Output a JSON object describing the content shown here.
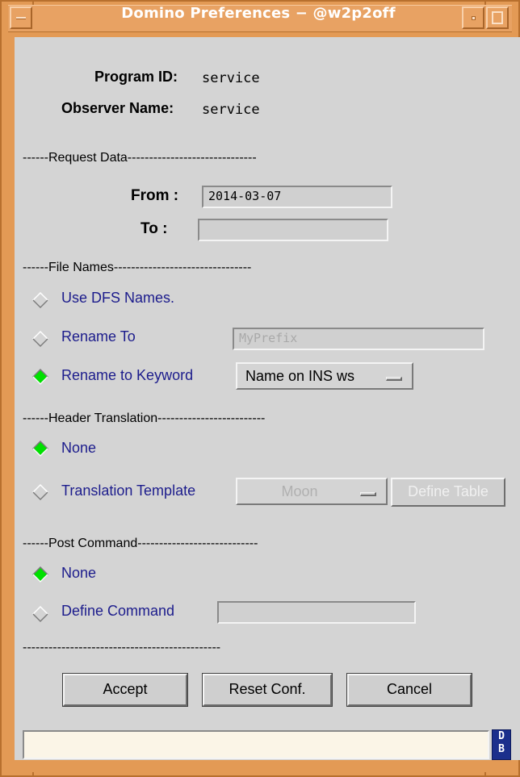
{
  "window": {
    "title": "Domino Preferences − @w2p2off"
  },
  "info": {
    "program_id_label": "Program ID:",
    "program_id_value": "service",
    "observer_label": "Observer Name:",
    "observer_value": "service"
  },
  "request_data": {
    "separator": "------Request Data------------------------------",
    "from_label": "From :",
    "from_value": "2014-03-07",
    "to_label": "To :",
    "to_value": ""
  },
  "file_names": {
    "separator": "------File Names--------------------------------",
    "use_dfs_label": "Use DFS Names.",
    "rename_to_label": "Rename To",
    "rename_to_value": "MyPrefix",
    "rename_keyword_label": "Rename to Keyword",
    "keyword_option": "Name on INS ws",
    "selected": "rename_keyword"
  },
  "header_translation": {
    "separator": "------Header Translation-------------------------",
    "none_label": "None",
    "template_label": "Translation Template",
    "template_option": "Moon",
    "define_table_label": "Define Table",
    "selected": "none"
  },
  "post_command": {
    "separator": "------Post Command----------------------------",
    "none_label": "None",
    "define_label": "Define Command",
    "define_value": "",
    "selected": "none"
  },
  "footer": {
    "separator": "----------------------------------------------",
    "accept_label": "Accept",
    "reset_label": "Reset Conf.",
    "cancel_label": "Cancel",
    "status_text": "",
    "logo_text_top": "D",
    "logo_text_bottom": "B"
  },
  "colors": {
    "frame": "#e39a55",
    "selected_radio": "#00e000",
    "label_blue": "#1c1c8c",
    "status_bg": "#fbf5e7"
  }
}
